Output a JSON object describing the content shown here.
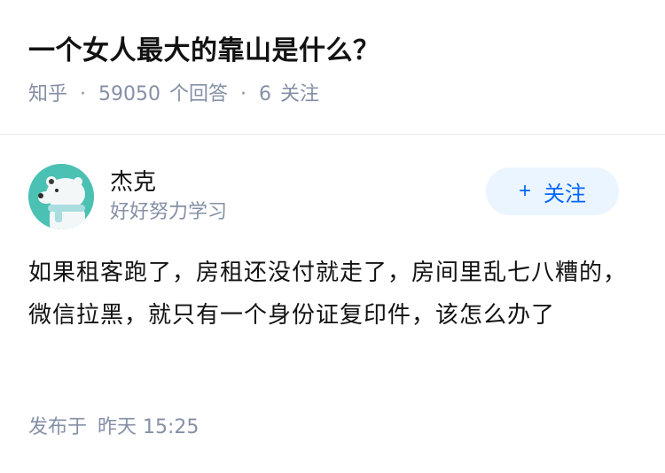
{
  "question": {
    "title": "一个女人最大的靠山是什么？",
    "source": "知乎",
    "answer_count": "59050",
    "answer_label": "个回答",
    "follow_count": "6",
    "follow_label": "关注"
  },
  "author": {
    "name": "杰克",
    "bio": "好好努力学习",
    "avatar_icon": "polar-bear-avatar",
    "follow_plus": "+",
    "follow_label": "关注"
  },
  "answer": {
    "content": "如果租客跑了，房租还没付就走了，房间里乱七八糟的，微信拉黑，就只有一个身份证复印件，该怎么办了",
    "time_prefix": "发布于",
    "time_value": "昨天 15:25"
  },
  "colors": {
    "accent": "#0066ff",
    "accent_bg": "#ebf5ff",
    "meta": "#8590a6",
    "avatar_bg": "#4bc1b4"
  }
}
